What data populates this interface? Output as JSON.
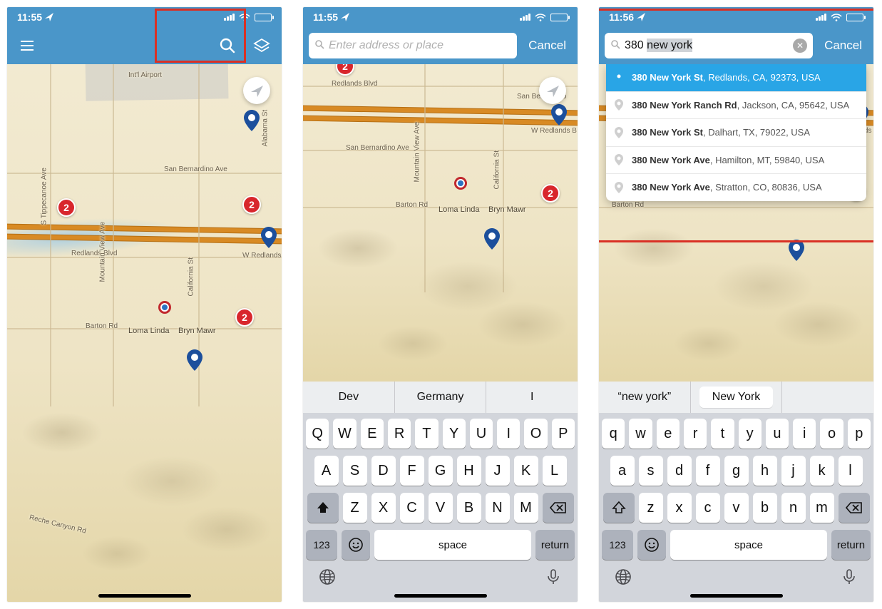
{
  "screen1": {
    "status": {
      "time": "11:55",
      "has_location_arrow": true
    },
    "map": {
      "labels": {
        "airport": "Int'l Airport",
        "san_bernardino_ave": "San Bernardino Ave",
        "redlands_blvd": "Redlands Blvd",
        "barton_rd": "Barton Rd",
        "loma_linda": "Loma Linda",
        "bryn_mawr": "Bryn Mawr",
        "reche_canyon": "Reche Canyon Rd",
        "mountain_view": "Mountain View Ave",
        "california_st": "California St",
        "alabama_st": "Alabama St",
        "tippecanoe": "S Tippecanoe Ave",
        "w_redlands": "W Redlands B"
      },
      "clusters": [
        {
          "count": "2"
        },
        {
          "count": "2"
        },
        {
          "count": "2"
        }
      ]
    }
  },
  "screen2": {
    "status": {
      "time": "11:55"
    },
    "search": {
      "placeholder": "Enter address or place",
      "cancel": "Cancel"
    },
    "kb_suggest": [
      "Dev",
      "Germany",
      "I"
    ],
    "map": {
      "labels": {
        "san_bernardino_ave": "San Bernardino Ave",
        "barton_rd": "Barton Rd",
        "loma_linda": "Loma Linda",
        "bryn_mawr": "Bryn Mawr",
        "mountain_view": "Mountain View Ave",
        "california_st": "California St",
        "redlands_blvd": "Redlands Blvd",
        "san_bernardino": "San Bernardino",
        "w_redlands": "W Redlands B"
      },
      "cluster": "2"
    },
    "keys": {
      "row1": [
        "Q",
        "W",
        "E",
        "R",
        "T",
        "Y",
        "U",
        "I",
        "O",
        "P"
      ],
      "row2": [
        "A",
        "S",
        "D",
        "F",
        "G",
        "H",
        "J",
        "K",
        "L"
      ],
      "row3": [
        "Z",
        "X",
        "C",
        "V",
        "B",
        "N",
        "M"
      ],
      "num": "123",
      "space": "space",
      "ret": "return"
    }
  },
  "screen3": {
    "status": {
      "time": "11:56"
    },
    "search": {
      "value_prefix": "380 ",
      "value_selected": "new york",
      "cancel": "Cancel"
    },
    "suggestions": [
      {
        "bold": "380 New York St",
        "rest": ", Redlands, CA, 92373, USA",
        "selected": true
      },
      {
        "bold": "380 New York Ranch Rd",
        "rest": ", Jackson, CA, 95642, USA",
        "selected": false
      },
      {
        "bold": "380 New York St",
        "rest": ", Dalhart, TX, 79022, USA",
        "selected": false
      },
      {
        "bold": "380 New York Ave",
        "rest": ", Hamilton, MT, 59840, USA",
        "selected": false
      },
      {
        "bold": "380 New York Ave",
        "rest": ", Stratton, CO, 80836, USA",
        "selected": false
      }
    ],
    "kb_suggest": [
      "“new york”",
      "New York",
      ""
    ],
    "map": {
      "labels": {
        "barton_rd": "Barton Rd",
        "w_redlands": "W Redlands"
      },
      "cluster": "2"
    },
    "keys": {
      "row1": [
        "q",
        "w",
        "e",
        "r",
        "t",
        "y",
        "u",
        "i",
        "o",
        "p"
      ],
      "row2": [
        "a",
        "s",
        "d",
        "f",
        "g",
        "h",
        "j",
        "k",
        "l"
      ],
      "row3": [
        "z",
        "x",
        "c",
        "v",
        "b",
        "n",
        "m"
      ],
      "num": "123",
      "space": "space",
      "ret": "return"
    }
  }
}
